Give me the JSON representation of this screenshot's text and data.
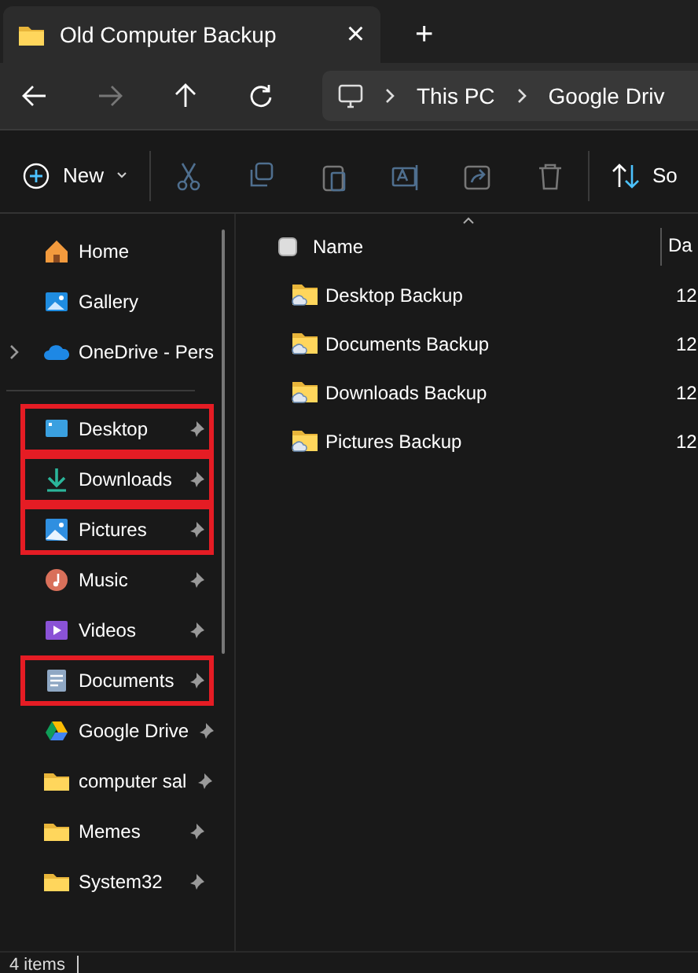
{
  "tab": {
    "title": "Old Computer Backup",
    "close": "×",
    "new_tab": "+"
  },
  "address": {
    "crumbs": [
      "This PC",
      "Google Driv"
    ]
  },
  "toolbar": {
    "new_label": "New",
    "sort_label": "So"
  },
  "sidebar": {
    "items": [
      {
        "label": "Home",
        "kind": "home",
        "pinned": false,
        "highlighted": false,
        "expandable": false
      },
      {
        "label": "Gallery",
        "kind": "gallery",
        "pinned": false,
        "highlighted": false,
        "expandable": false
      },
      {
        "label": "OneDrive - Pers",
        "kind": "cloud",
        "pinned": false,
        "highlighted": false,
        "expandable": true
      },
      {
        "label": "Desktop",
        "kind": "desktop",
        "pinned": true,
        "highlighted": true,
        "expandable": false,
        "section_start": true
      },
      {
        "label": "Downloads",
        "kind": "download",
        "pinned": true,
        "highlighted": true,
        "expandable": false
      },
      {
        "label": "Pictures",
        "kind": "pictures",
        "pinned": true,
        "highlighted": true,
        "expandable": false
      },
      {
        "label": "Music",
        "kind": "music",
        "pinned": true,
        "highlighted": false,
        "expandable": false
      },
      {
        "label": "Videos",
        "kind": "videos",
        "pinned": true,
        "highlighted": false,
        "expandable": false
      },
      {
        "label": "Documents",
        "kind": "documents",
        "pinned": true,
        "highlighted": true,
        "expandable": false
      },
      {
        "label": "Google Drive",
        "kind": "drive",
        "pinned": true,
        "highlighted": false,
        "expandable": false
      },
      {
        "label": "computer sal",
        "kind": "folder",
        "pinned": true,
        "highlighted": false,
        "expandable": false
      },
      {
        "label": "Memes",
        "kind": "folder",
        "pinned": true,
        "highlighted": false,
        "expandable": false
      },
      {
        "label": "System32",
        "kind": "folder",
        "pinned": true,
        "highlighted": false,
        "expandable": false
      }
    ]
  },
  "table": {
    "columns": [
      "Name",
      "Da"
    ],
    "select_all_checked": false,
    "rows": [
      {
        "name": "Desktop Backup",
        "column_2": "12"
      },
      {
        "name": "Documents Backup",
        "column_2": "12"
      },
      {
        "name": "Downloads Backup",
        "column_2": "12"
      },
      {
        "name": "Pictures Backup",
        "column_2": "12"
      }
    ]
  },
  "status_bar": {
    "count": "4 items"
  }
}
